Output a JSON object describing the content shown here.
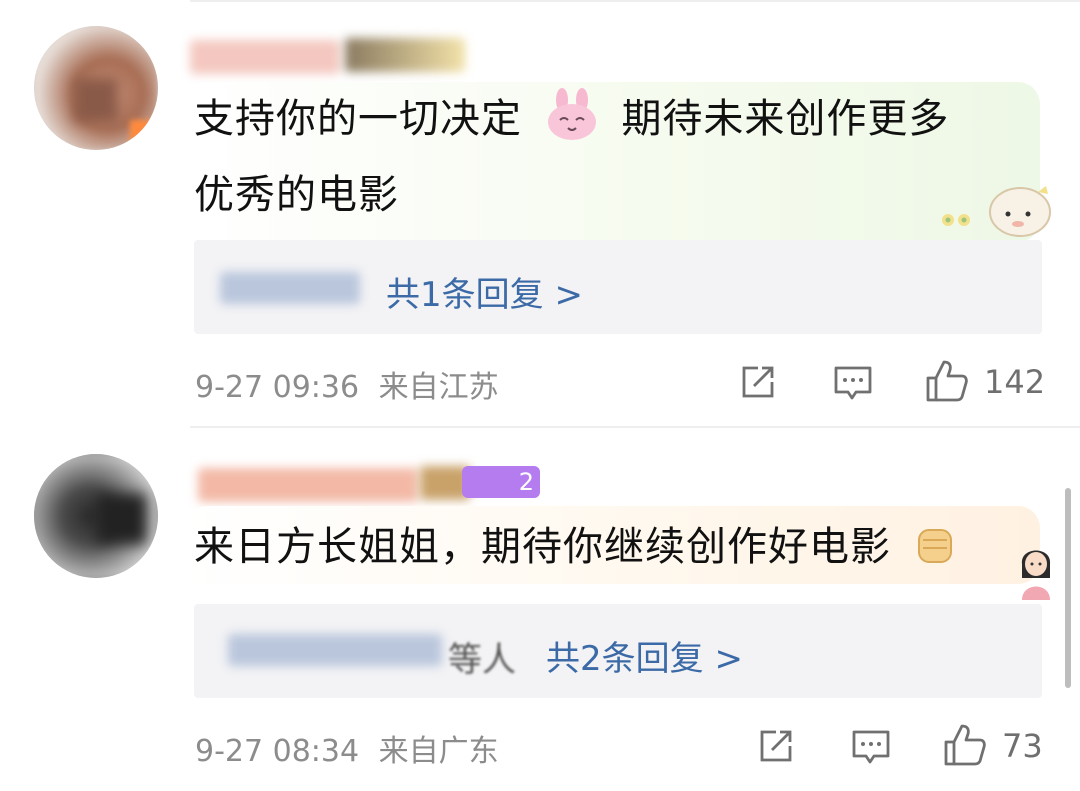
{
  "comments": [
    {
      "text": "支持你的一切决定",
      "emoji_icon": "bunny-face-emoji",
      "text_after": "期待未来创作更多",
      "text_line2": "优秀的电影",
      "replies_link": "共1条回复 >",
      "date": "9-27 09:36",
      "location": "来自江苏",
      "likes": "142"
    },
    {
      "text": "来日方长姐姐，期待你继续创作好电影",
      "emoji_icon": "fist-emoji",
      "badge_text": "2",
      "reply_preview_tail": "等人",
      "replies_link": "共2条回复 >",
      "date": "9-27 08:34",
      "location": "来自广东",
      "likes": "73"
    }
  ],
  "colors": {
    "link": "#3b6aa6",
    "meta": "#8c8c8c",
    "reply_bg": "#f3f3f5",
    "badge": "#b57cf0"
  }
}
